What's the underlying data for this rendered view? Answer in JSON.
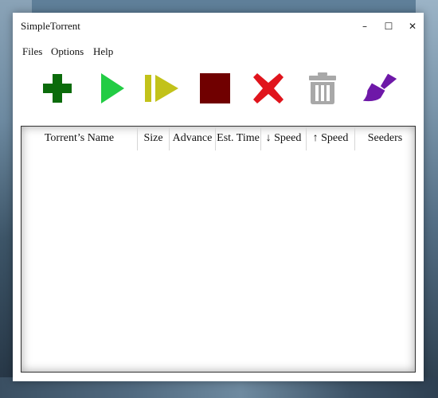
{
  "window": {
    "title": "SimpleTorrent",
    "minimize_glyph": "–",
    "maximize_glyph": "☐",
    "close_glyph": "✕"
  },
  "menu": {
    "items": [
      {
        "label": "Files"
      },
      {
        "label": "Options"
      },
      {
        "label": "Help"
      }
    ]
  },
  "toolbar": {
    "buttons": [
      {
        "icon": "add-icon",
        "color": "#0b6b0b"
      },
      {
        "icon": "play-icon",
        "color": "#22cc44"
      },
      {
        "icon": "resume-icon",
        "color": "#c2c21a"
      },
      {
        "icon": "stop-icon",
        "color": "#700000"
      },
      {
        "icon": "remove-icon",
        "color": "#e0141c"
      },
      {
        "icon": "trash-icon",
        "color": "#a8a8a8"
      },
      {
        "icon": "clean-icon",
        "color": "#6e18a8"
      }
    ]
  },
  "torrent_list": {
    "columns": [
      {
        "label": "Torrent’s Name"
      },
      {
        "label": "Size"
      },
      {
        "label": "Advance"
      },
      {
        "label": "Est. Time"
      },
      {
        "label": "↓ Speed"
      },
      {
        "label": "↑ Speed"
      },
      {
        "label": "Seeders"
      }
    ],
    "rows": []
  }
}
